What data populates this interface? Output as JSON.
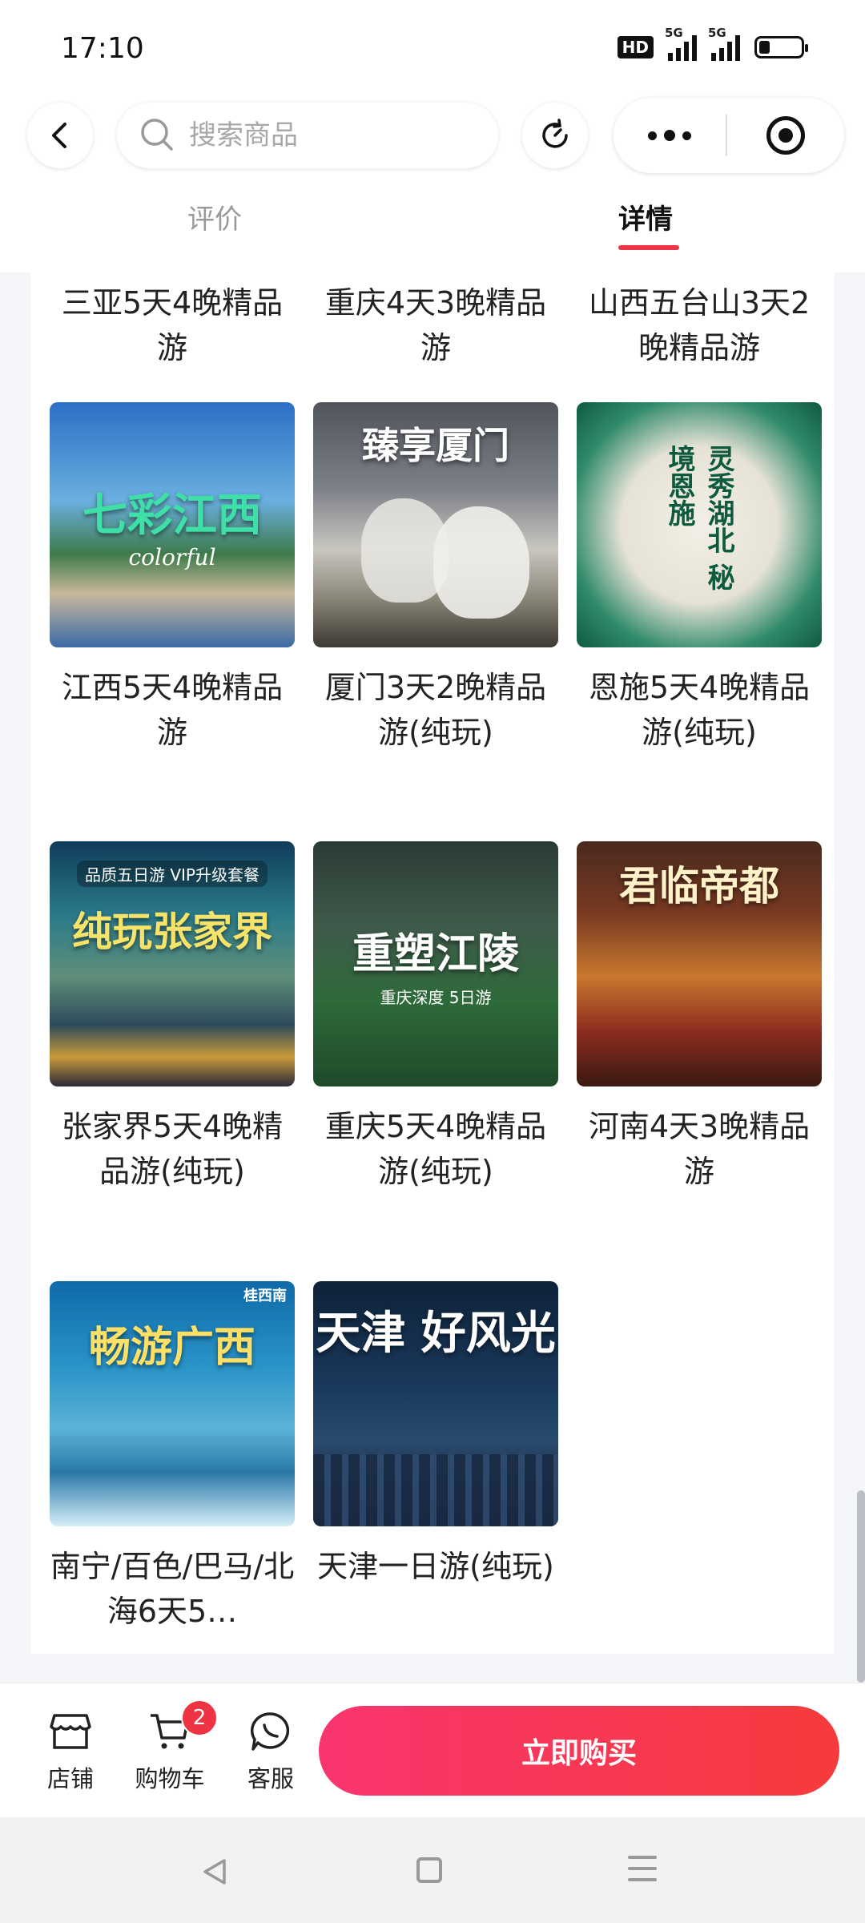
{
  "status_bar": {
    "time": "17:10",
    "hd_label": "HD",
    "signal1_label": "5G",
    "signal2_label": "5G",
    "battery_level": 0.25
  },
  "header": {
    "search_placeholder": "搜索商品",
    "tabs": [
      {
        "label": "评价",
        "active": false
      },
      {
        "label": "详情",
        "active": true
      }
    ],
    "accent_color": "#ee3342"
  },
  "products": [
    {
      "name": "三亚5天4晚精品游"
    },
    {
      "name": "重庆4天3晚精品游"
    },
    {
      "name": "山西五台山3天2晚精品游"
    },
    {
      "name": "江西5天4晚精品游",
      "image_text": "七彩江西",
      "image_subtext": "colorful"
    },
    {
      "name": "厦门3天2晚精品游(纯玩)",
      "image_text": "臻享厦门"
    },
    {
      "name": "恩施5天4晚精品游(纯玩)",
      "image_text": "灵秀湖北 秘境恩施"
    },
    {
      "name": "张家界5天4晚精品游(纯玩)",
      "image_text": "纯玩张家界",
      "image_subtext": "品质五日游 VIP升级套餐"
    },
    {
      "name": "重庆5天4晚精品游(纯玩)",
      "image_text": "重塑江陵",
      "image_subtext": "重庆深度 5日游"
    },
    {
      "name": "河南4天3晚精品游",
      "image_text": "君临帝都"
    },
    {
      "name": "南宁/百色/巴马/北海6天5…",
      "image_text": "畅游广西",
      "image_subtext": "桂西南"
    },
    {
      "name": "天津一日游(纯玩)",
      "image_text": "天津 好风光"
    }
  ],
  "bottom_bar": {
    "shop_label": "店铺",
    "cart_label": "购物车",
    "cart_count": "2",
    "service_label": "客服",
    "buy_label": "立即购买"
  }
}
